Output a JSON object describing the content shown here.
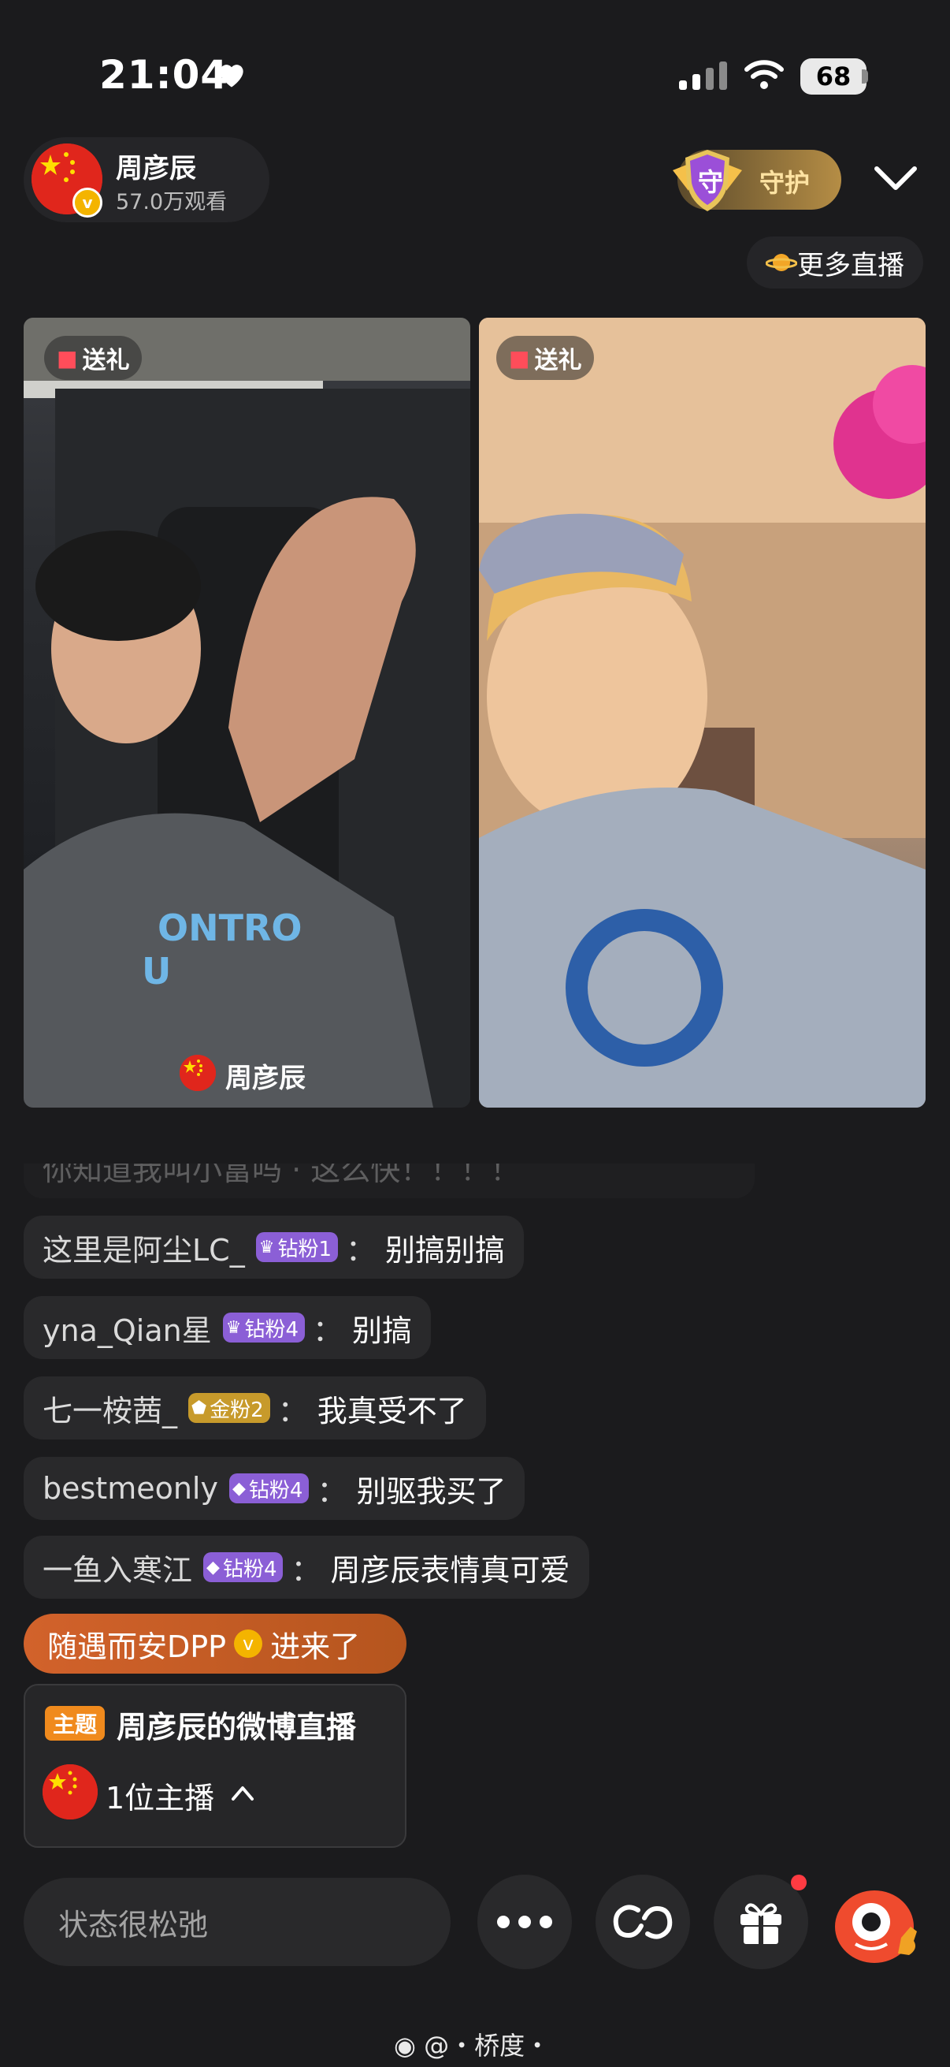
{
  "status_bar": {
    "time": "21:04",
    "battery": "68"
  },
  "host": {
    "name": "周彦辰",
    "views": "57.0万观看"
  },
  "guard": {
    "label": "守护",
    "badge_char": "守"
  },
  "more_live": {
    "label": "更多直播"
  },
  "video": {
    "left": {
      "gift_label": "送礼",
      "streamer_name": "周彦辰"
    },
    "right": {
      "gift_label": "送礼"
    }
  },
  "chat": {
    "partial": {
      "text": "你知道我叫小富吗 · 这么快！！！！"
    },
    "items": [
      {
        "user": "这里是阿尘LC_",
        "badge": "钻粉1",
        "badge_type": "crown",
        "message": "别搞别搞"
      },
      {
        "user": "yna_Qian星",
        "badge": "钻粉4",
        "badge_type": "crown",
        "message": "别搞"
      },
      {
        "user": "七一桉茜_",
        "badge": "金粉2",
        "badge_type": "gold",
        "message": "我真受不了"
      },
      {
        "user": "bestmeonly",
        "badge": "钻粉4",
        "badge_type": "diamond",
        "message": "别驱我买了"
      },
      {
        "user": "一鱼入寒江",
        "badge": "钻粉4",
        "badge_type": "diamond",
        "message": "周彦辰表情真可爱"
      }
    ],
    "separator": "："
  },
  "entry": {
    "user": "随遇而安DPP",
    "action": "进来了"
  },
  "topic": {
    "tag": "主题",
    "title": "周彦辰的微博直播",
    "count": "1位主播"
  },
  "input": {
    "placeholder": "状态很松弛"
  },
  "footer": {
    "watermark": "@・桥度・"
  },
  "colors": {
    "background": "#1b1b1d",
    "entry_orange": "#d2622b",
    "topic_tag": "#f08a1d",
    "badge_purple": "#8b5fd6",
    "badge_gold": "#c79a2b",
    "notif_red": "#ff3b42"
  },
  "icons": [
    "heart-icon",
    "signal-icon",
    "wifi-icon",
    "battery-icon",
    "verified-icon",
    "guard-shield-icon",
    "chevron-down-icon",
    "planet-icon",
    "gift-icon",
    "flag-avatar",
    "chevron-up-icon",
    "more-dots-icon",
    "link-icon",
    "gift-box-icon",
    "mascot-icon",
    "weibo-icon"
  ]
}
